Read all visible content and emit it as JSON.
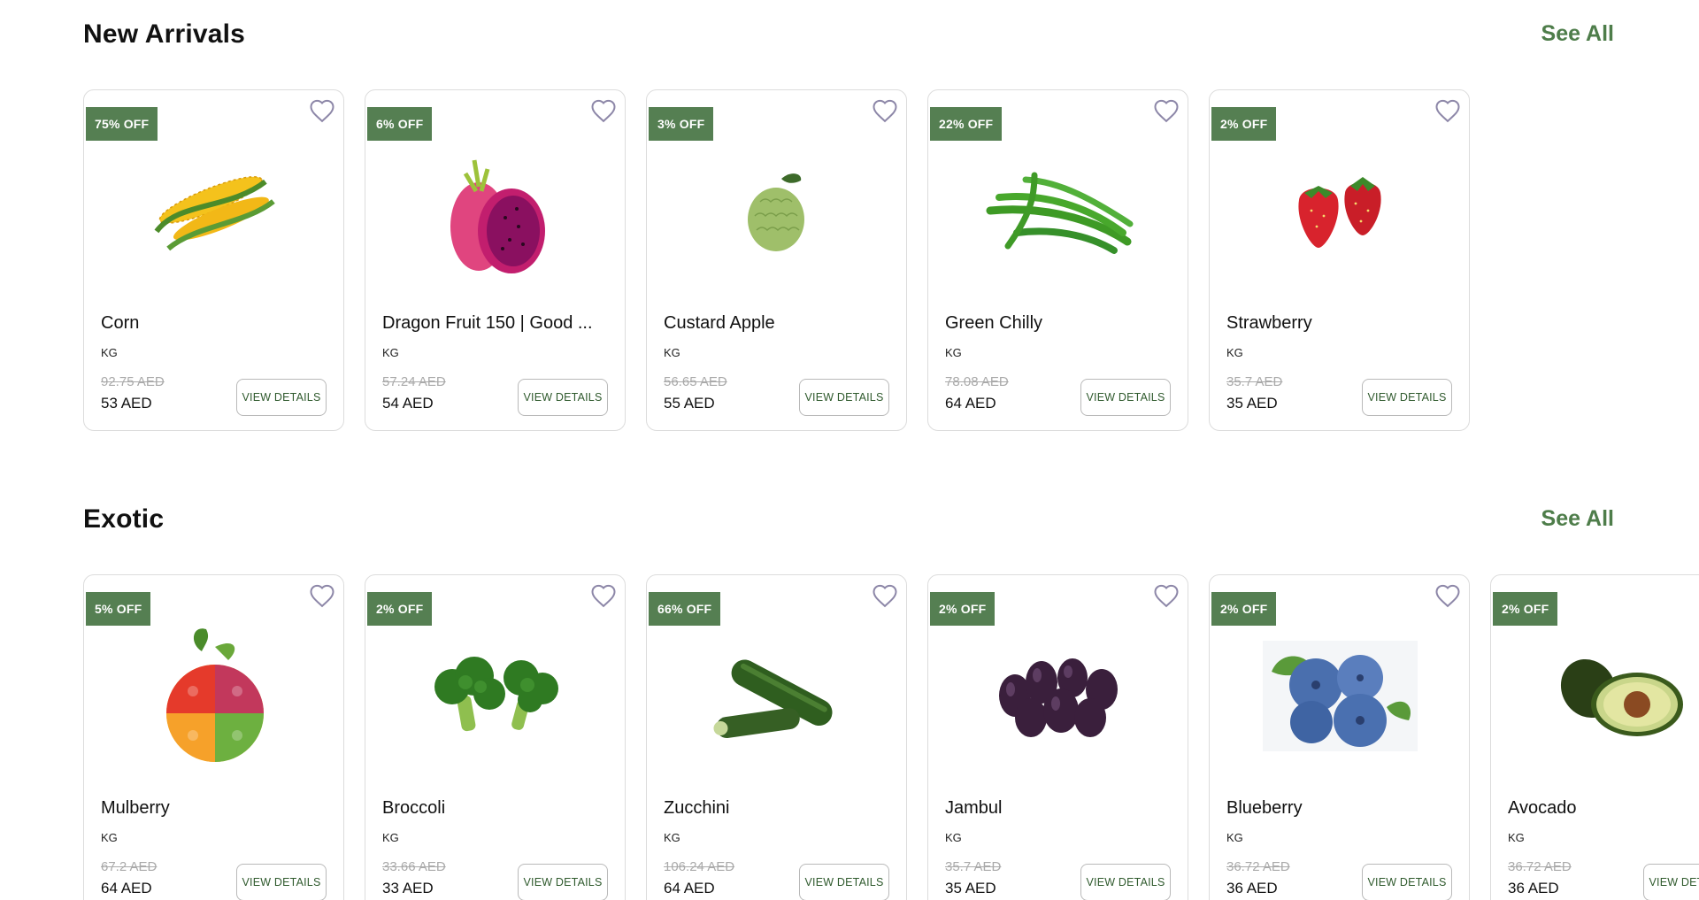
{
  "sections": [
    {
      "title": "New Arrivals",
      "see_all": "See All",
      "products": [
        {
          "badge": "75% OFF",
          "name": "Corn",
          "unit": "KG",
          "old_price": "92.75 AED",
          "price": "53 AED",
          "button": "VIEW DETAILS",
          "image": "corn"
        },
        {
          "badge": "6% OFF",
          "name": "Dragon Fruit 150 | Good ...",
          "unit": "KG",
          "old_price": "57.24 AED",
          "price": "54 AED",
          "button": "VIEW DETAILS",
          "image": "dragon-fruit"
        },
        {
          "badge": "3% OFF",
          "name": "Custard Apple",
          "unit": "KG",
          "old_price": "56.65 AED",
          "price": "55 AED",
          "button": "VIEW DETAILS",
          "image": "custard-apple"
        },
        {
          "badge": "22% OFF",
          "name": "Green Chilly",
          "unit": "KG",
          "old_price": "78.08 AED",
          "price": "64 AED",
          "button": "VIEW DETAILS",
          "image": "green-chilly"
        },
        {
          "badge": "2% OFF",
          "name": "Strawberry",
          "unit": "KG",
          "old_price": "35.7 AED",
          "price": "35 AED",
          "button": "VIEW DETAILS",
          "image": "strawberry"
        }
      ]
    },
    {
      "title": "Exotic",
      "see_all": "See All",
      "products": [
        {
          "badge": "5% OFF",
          "name": "Mulberry",
          "unit": "KG",
          "old_price": "67.2 AED",
          "price": "64 AED",
          "button": "VIEW DETAILS",
          "image": "mixed-produce"
        },
        {
          "badge": "2% OFF",
          "name": "Broccoli",
          "unit": "KG",
          "old_price": "33.66 AED",
          "price": "33 AED",
          "button": "VIEW DETAILS",
          "image": "broccoli"
        },
        {
          "badge": "66% OFF",
          "name": "Zucchini",
          "unit": "KG",
          "old_price": "106.24 AED",
          "price": "64 AED",
          "button": "VIEW DETAILS",
          "image": "zucchini"
        },
        {
          "badge": "2% OFF",
          "name": "Jambul",
          "unit": "KG",
          "old_price": "35.7 AED",
          "price": "35 AED",
          "button": "VIEW DETAILS",
          "image": "jambul"
        },
        {
          "badge": "2% OFF",
          "name": "Blueberry",
          "unit": "KG",
          "old_price": "36.72 AED",
          "price": "36 AED",
          "button": "VIEW DETAILS",
          "image": "blueberry"
        },
        {
          "badge": "2% OFF",
          "name": "Avocado",
          "unit": "KG",
          "old_price": "36.72 AED",
          "price": "36 AED",
          "button": "VIEW DETAILS",
          "image": "avocado"
        }
      ]
    }
  ],
  "colors": {
    "accent": "#557f52",
    "see_all": "#4e7d4a",
    "heart": "#8d87a8"
  },
  "icons": {
    "wishlist": "heart-outline-icon"
  }
}
